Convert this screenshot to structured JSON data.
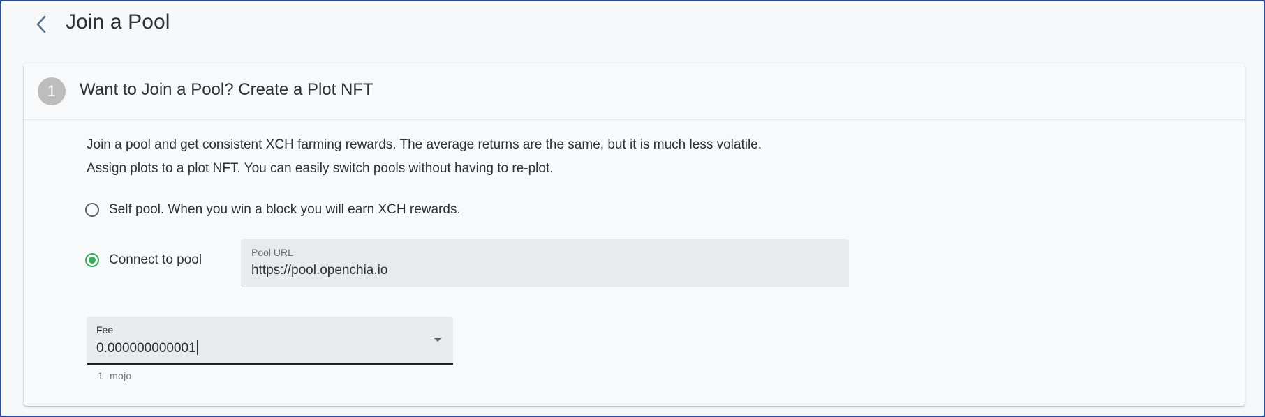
{
  "header": {
    "title": "Join a Pool",
    "back_icon": "chevron-left-icon"
  },
  "card": {
    "step_number": "1",
    "title": "Want to Join a Pool? Create a Plot NFT",
    "description_1": "Join a pool and get consistent XCH farming rewards. The average returns are the same, but it is much less volatile.",
    "description_2": "Assign plots to a plot NFT. You can easily switch pools without having to re-plot.",
    "options": [
      {
        "label": "Self pool. When you win a block you will earn XCH rewards.",
        "selected": false
      },
      {
        "label": "Connect to pool",
        "selected": true
      }
    ],
    "pool_url": {
      "label": "Pool URL",
      "value": "https://pool.openchia.io"
    },
    "fee": {
      "label": "Fee",
      "value": "0.000000000001",
      "helper_amount": "1",
      "helper_unit": "mojo"
    }
  },
  "colors": {
    "accent_green": "#3aac59",
    "step_badge": "#bdbdbd",
    "border": "#2b4a9a"
  }
}
